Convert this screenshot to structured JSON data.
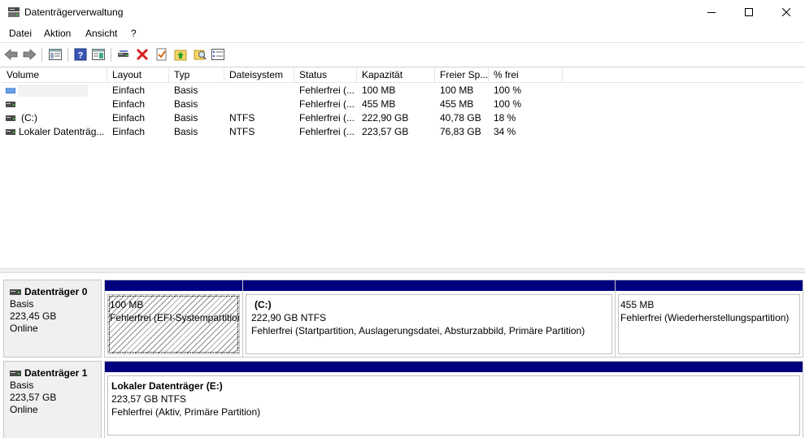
{
  "window": {
    "title": "Datenträgerverwaltung"
  },
  "menu": [
    "Datei",
    "Aktion",
    "Ansicht",
    "?"
  ],
  "toolbar": [
    "back-icon",
    "forward-icon",
    "console-tree-icon",
    "help-icon",
    "properties-icon",
    "connect-icon",
    "delete-icon",
    "check-icon",
    "folder-up-icon",
    "search-folder-icon",
    "list-view-icon"
  ],
  "volume_list": {
    "columns": [
      "Volume",
      "Layout",
      "Typ",
      "Dateisystem",
      "Status",
      "Kapazität",
      "Freier Sp...",
      "% frei"
    ],
    "rows": [
      {
        "volume": "",
        "layout": "Einfach",
        "typ": "Basis",
        "fs": "",
        "status": "Fehlerfrei (...",
        "capacity": "100 MB",
        "free": "100 MB",
        "pct": "100 %"
      },
      {
        "volume": "",
        "layout": "Einfach",
        "typ": "Basis",
        "fs": "",
        "status": "Fehlerfrei (...",
        "capacity": "455 MB",
        "free": "455 MB",
        "pct": "100 %"
      },
      {
        "volume": "(C:)",
        "layout": "Einfach",
        "typ": "Basis",
        "fs": "NTFS",
        "status": "Fehlerfrei (...",
        "capacity": "222,90 GB",
        "free": "40,78 GB",
        "pct": "18 %"
      },
      {
        "volume": "Lokaler Datenträg...",
        "layout": "Einfach",
        "typ": "Basis",
        "fs": "NTFS",
        "status": "Fehlerfrei (...",
        "capacity": "223,57 GB",
        "free": "76,83 GB",
        "pct": "34 %"
      }
    ]
  },
  "disks": [
    {
      "name": "Datenträger 0",
      "type": "Basis",
      "size": "223,45 GB",
      "state": "Online",
      "partitions": [
        {
          "title": "",
          "size": "100 MB",
          "status": "Fehlerfrei (EFI-Systempartition)"
        },
        {
          "title": "(C:)",
          "size": "222,90 GB NTFS",
          "status": "Fehlerfrei (Startpartition, Auslagerungsdatei, Absturzabbild, Primäre Partition)"
        },
        {
          "title": "",
          "size": "455 MB",
          "status": "Fehlerfrei (Wiederherstellungspartition)"
        }
      ]
    },
    {
      "name": "Datenträger 1",
      "type": "Basis",
      "size": "223,57 GB",
      "state": "Online",
      "partitions": [
        {
          "title": "Lokaler Datenträger  (E:)",
          "size": "223,57 GB NTFS",
          "status": "Fehlerfrei (Aktiv, Primäre Partition)"
        }
      ]
    }
  ],
  "colors": {
    "partition_bar": "#00007f",
    "info_panel": "#f0f0f0"
  }
}
